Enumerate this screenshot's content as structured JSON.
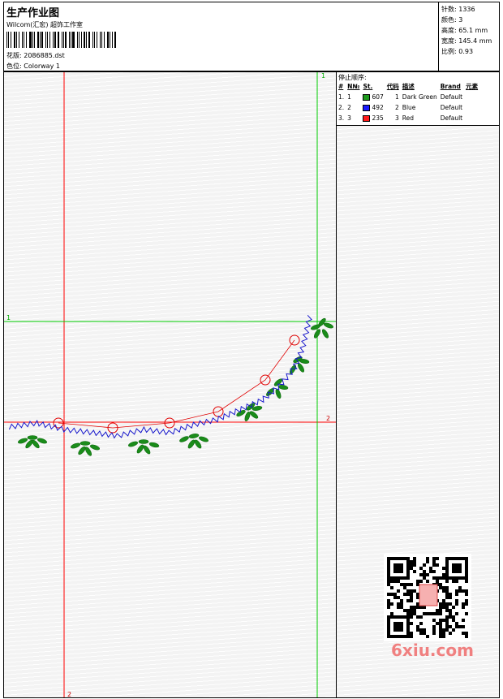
{
  "header": {
    "title": "生产作业图",
    "studio": "Wilcom(汇宏) 超饰工作室",
    "design_label": "花版:",
    "design_value": "2086885.dst",
    "colorway_label": "色位:",
    "colorway_value": "Colorway 1"
  },
  "stats": {
    "stitches_label": "针数:",
    "stitches_value": "1336",
    "colors_label": "颜色:",
    "colors_value": "3",
    "height_label": "高度:",
    "height_value": "65.1 mm",
    "width_label": "宽度:",
    "width_value": "145.4 mm",
    "scale_label": "比例:",
    "scale_value": "0.93"
  },
  "canvas": {
    "guide_labels": {
      "green_top": "1",
      "green_left": "1",
      "red_right": "2",
      "red_bottom": "2"
    },
    "colors": {
      "red_guide": "#ff0000",
      "green_guide": "#00cc00",
      "blue_stitch": "#0000cc",
      "green_stitch": "#1a8c1a",
      "marker": "#e00000"
    }
  },
  "stop_sequence": {
    "title": "停止顺序:",
    "columns": [
      "#",
      "N№",
      "St.",
      "代码",
      "描述",
      "Brand",
      "元素"
    ],
    "rows": [
      {
        "index": "1.",
        "n": "1",
        "color": "#1e9a1e",
        "stitches": "607",
        "code": "1",
        "description": "Dark Green",
        "brand": "Default"
      },
      {
        "index": "2.",
        "n": "2",
        "color": "#1a1aff",
        "stitches": "492",
        "code": "2",
        "description": "Blue",
        "brand": "Default"
      },
      {
        "index": "3.",
        "n": "3",
        "color": "#ff1a1a",
        "stitches": "235",
        "code": "3",
        "description": "Red",
        "brand": "Default"
      }
    ]
  },
  "watermark": {
    "text": "6xiu.com"
  }
}
